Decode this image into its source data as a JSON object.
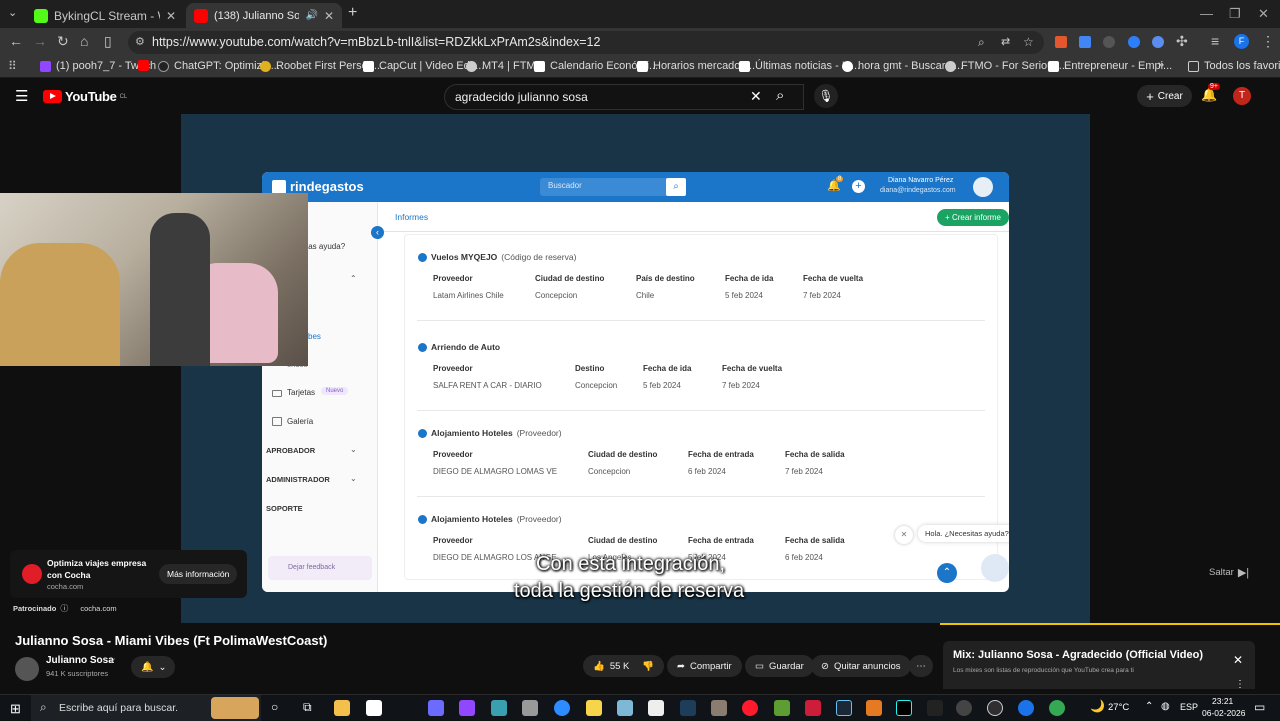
{
  "tabs": [
    {
      "label": "BykingCL Stream - Watch Live o",
      "active": false,
      "favicon_color": "#53fc18"
    },
    {
      "label": "(138) Julianno Sosa - Miam",
      "active": true,
      "favicon_color": "#ff0000"
    }
  ],
  "address": {
    "url": "https://www.youtube.com/watch?v=mBbzLb-tnlI&list=RDZkkLxPrAm2s&index=12"
  },
  "bookmarks": [
    "(1) pooh7_7 - Twitch",
    "ChatGPT: Optimizin...",
    "Roobet First Person...",
    "CapCut | Video Edit...",
    "MT4 | FTMO",
    "Calendario Económi...",
    "Horarios mercados...",
    "Últimas noticias - In...",
    "hora gmt - Buscar c...",
    "FTMO - For Serious...",
    "Entrepreneur - Empi..."
  ],
  "bookmarks_all": "Todos los favoritos",
  "youtube": {
    "logo": "YouTube",
    "country": "CL",
    "search_value": "agradecido julianno sosa",
    "create_label": "Crear",
    "notif_badge": "9+",
    "avatar_letter": "T"
  },
  "rindegastos": {
    "logo": "rindegastos",
    "search_placeholder": "Buscador",
    "user_name": "Diana Navarro Pérez",
    "user_email": "diana@rindegastos.com",
    "notif_count": "8",
    "tab_left": "rindegastos",
    "tab_active": "Informes",
    "create_button": "+ Crear informe",
    "help_text": "tas ayuda?",
    "side_items": {
      "tarjetas": "Tarjetas",
      "nuevo": "Nuevo",
      "galeria": "Galería",
      "viajes": "bes",
      "fondos": "ondos"
    },
    "sections": [
      "APROBADOR",
      "ADMINISTRADOR",
      "SOPORTE"
    ],
    "feedback": "Dejar feedback",
    "chat_bubble": "Hola. ¿Necesitas ayuda?",
    "cards": [
      {
        "title": "Vuelos  MYQEJO",
        "note": "(Código de reserva)",
        "headers": [
          "Proveedor",
          "Ciudad de destino",
          "País de destino",
          "Fecha de ida",
          "Fecha de vuelta"
        ],
        "values": [
          "Latam Airlines Chile",
          "Concepcion",
          "Chile",
          "5 feb 2024",
          "7 feb 2024"
        ]
      },
      {
        "title": "Arriendo de Auto",
        "note": "",
        "headers": [
          "Proveedor",
          "Destino",
          "Fecha de ida",
          "Fecha de vuelta"
        ],
        "values": [
          "SALFA RENT A CAR - DIARIO",
          "Concepcion",
          "5 feb 2024",
          "7 feb 2024"
        ]
      },
      {
        "title": "Alojamiento  Hoteles",
        "note": "(Proveedor)",
        "headers": [
          "Proveedor",
          "Ciudad de destino",
          "Fecha de entrada",
          "Fecha de salida"
        ],
        "values": [
          "DIEGO DE ALMAGRO LOMAS VE",
          "Concepcion",
          "6 feb 2024",
          "7 feb 2024"
        ]
      },
      {
        "title": "Alojamiento  Hoteles",
        "note": "(Proveedor)",
        "headers": [
          "Proveedor",
          "Ciudad de destino",
          "Fecha de entrada",
          "Fecha de salida"
        ],
        "values": [
          "DIEGO DE ALMAGRO LOS ANGE",
          "Los Angeles",
          "5 feb 2024",
          "6 feb 2024"
        ]
      }
    ]
  },
  "subtitles": [
    "Con esta integración,",
    "toda la gestión de reserva"
  ],
  "skip_label": "Saltar",
  "sponsor": {
    "title_line1": "Optimiza viajes empresa",
    "title_line2": "con Cocha",
    "domain": "cocha.com",
    "cta": "Más información",
    "sponsored": "Patrocinado",
    "site": "cocha.com"
  },
  "video": {
    "title": "Julianno Sosa - Miami Vibes (Ft PolimaWestCoast)",
    "channel": "Julianno Sosa",
    "subscribers": "941 K suscriptores",
    "likes": "55 K",
    "share": "Compartir",
    "save": "Guardar",
    "remove_ads": "Quitar anuncios"
  },
  "mix": {
    "title": "Mix: Julianno Sosa - Agradecido (Official Video)",
    "subtitle": "Los mixes son listas de reproducción que YouTube crea para ti"
  },
  "taskbar": {
    "search_placeholder": "Escribe aquí para buscar.",
    "temperature": "27°C",
    "language": "ESP",
    "time": "23:21",
    "date": "06-02-2026"
  }
}
